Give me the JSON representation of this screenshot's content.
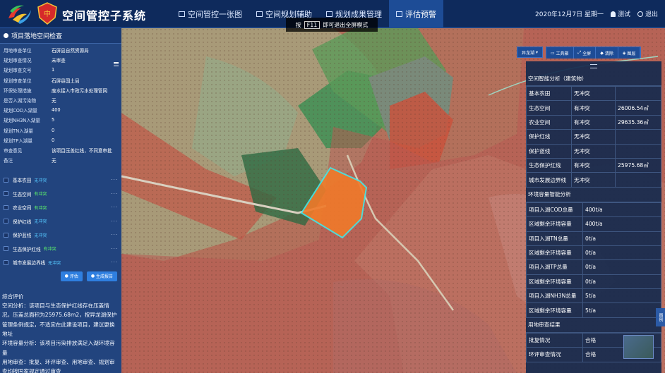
{
  "app": {
    "title": "空间管控子系统"
  },
  "nav": [
    {
      "label": "空间管控一张图"
    },
    {
      "label": "空间规划辅助"
    },
    {
      "label": "规划成果管理"
    },
    {
      "label": "评估预警"
    }
  ],
  "header": {
    "date": "2020年12月7日 星期一",
    "user": "测试",
    "logout": "退出"
  },
  "fullscreen_hint": {
    "prefix": "按",
    "key": "F11",
    "suffix": "即可退出全屏模式"
  },
  "left_panel": {
    "title": "项目落地空间检查",
    "fields": [
      {
        "k": "用地审查单位",
        "v": "石屏县自然资源局"
      },
      {
        "k": "规划审查情况",
        "v": "未审查"
      },
      {
        "k": "规划审查文号",
        "v": "1"
      },
      {
        "k": "规划审查单位",
        "v": "石屏县国土局"
      },
      {
        "k": "环保处理措施",
        "v": "废水接入市政污水处理管网"
      },
      {
        "k": "是否入湖污染物",
        "v": "无"
      },
      {
        "k": "规划COD入湖量",
        "v": "400"
      },
      {
        "k": "规划NH3N入湖量",
        "v": "5"
      },
      {
        "k": "规划TN入湖量",
        "v": "0"
      },
      {
        "k": "规划TP入湖量",
        "v": "0"
      },
      {
        "k": "审查意见",
        "v": "该项目压盖红线，不同意审批"
      },
      {
        "k": "备注",
        "v": "无"
      }
    ],
    "checks": [
      {
        "label": "基本农田",
        "status": "无冲突",
        "color": "blue"
      },
      {
        "label": "生态空间",
        "status": "有冲突",
        "color": "green"
      },
      {
        "label": "农业空间",
        "status": "有冲突",
        "color": "green"
      },
      {
        "label": "保护红线",
        "status": "无冲突",
        "color": "blue"
      },
      {
        "label": "保护蓝线",
        "status": "无冲突",
        "color": "blue"
      },
      {
        "label": "生态保护红线",
        "status": "有冲突",
        "color": "green"
      },
      {
        "label": "城市发展边界线",
        "status": "无冲突",
        "color": "blue"
      }
    ],
    "btn_eval": "评估",
    "btn_report": "生成报告",
    "summary": "综合评价\n空间分析：该项目与生态保护红线存在压盖情况，压盖总面积为25975.68m2，按异龙湖保护管理条例规定，不适宜在此建设项目，建议更换地址\n环境容量分析：该项目污染排放满足入湖环境容量\n用地审查：批复、环评审查、用地审查、规划审查均按国家规定通过审查"
  },
  "toolbar": {
    "lake": "异龙湖",
    "tools": "工具箱",
    "full": "全屏",
    "clear": "清除",
    "layers": "图层"
  },
  "right_panel": {
    "section1": "空间智能分析（建筑物）",
    "rows1": [
      {
        "a": "基本农田",
        "b": "无冲突",
        "c": ""
      },
      {
        "a": "生态空间",
        "b": "有冲突",
        "c": "26006.54㎡"
      },
      {
        "a": "农业空间",
        "b": "有冲突",
        "c": "29635.36㎡"
      },
      {
        "a": "保护红线",
        "b": "无冲突",
        "c": ""
      },
      {
        "a": "保护蓝线",
        "b": "无冲突",
        "c": ""
      },
      {
        "a": "生态保护红线",
        "b": "有冲突",
        "c": "25975.68㎡"
      },
      {
        "a": "城市发展边界线",
        "b": "无冲突",
        "c": ""
      }
    ],
    "section2": "环境容量智能分析",
    "rows2": [
      {
        "a": "项目入湖COD总量",
        "b": "400t/a"
      },
      {
        "a": "区域剩余环境容量",
        "b": "400t/a"
      },
      {
        "a": "项目入湖TN总量",
        "b": "0t/a"
      },
      {
        "a": "区域剩余环境容量",
        "b": "0t/a"
      },
      {
        "a": "项目入湖TP总量",
        "b": "0t/a"
      },
      {
        "a": "区域剩余环境容量",
        "b": "0t/a"
      },
      {
        "a": "项目入湖NH3N总量",
        "b": "5t/a"
      },
      {
        "a": "区域剩余环境容量",
        "b": "5t/a"
      }
    ],
    "section3": "用地审查结果",
    "rows3": [
      {
        "a": "批复情况",
        "b": "合格"
      },
      {
        "a": "环评审查情况",
        "b": "合格"
      }
    ]
  },
  "side_tab": "图例"
}
